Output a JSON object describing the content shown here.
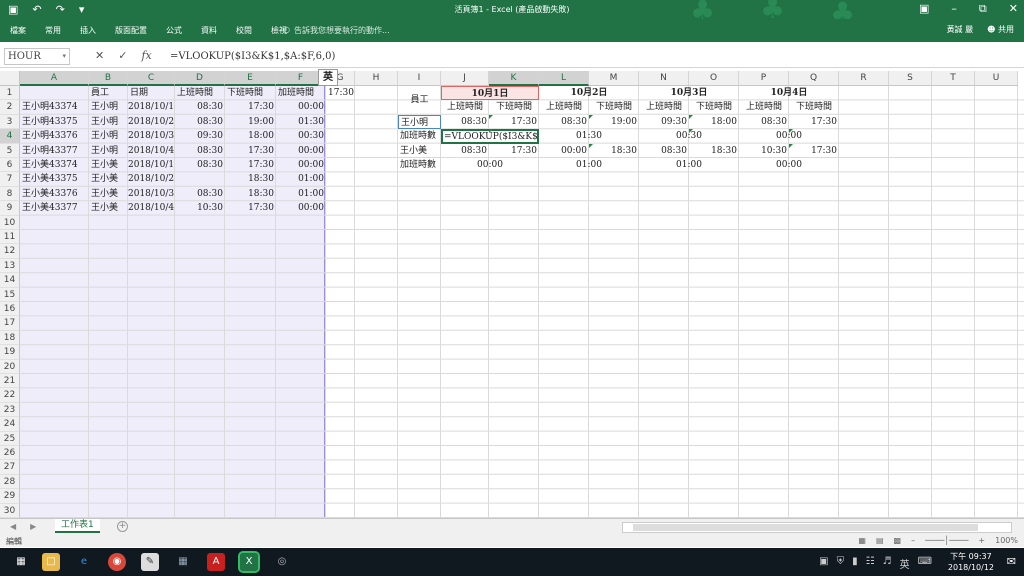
{
  "window": {
    "title": "活頁簿1 - Excel (產品啟動失敗)",
    "qat_icons": [
      "save-icon",
      "undo-icon",
      "redo-icon",
      "customize-icon"
    ]
  },
  "ribbon": {
    "tabs": [
      "檔案",
      "常用",
      "插入",
      "版面配置",
      "公式",
      "資料",
      "校閱",
      "檢視"
    ],
    "tell_me": "告訴我您想要執行的動作...",
    "user": "黃誠 嚴",
    "share": "共用"
  },
  "formula_bar": {
    "name_box": "HOUR",
    "formula": "=VLOOKUP($I3&K$1,$A:$F,6,0)"
  },
  "columns": [
    "A",
    "B",
    "C",
    "D",
    "E",
    "F",
    "G",
    "H",
    "I",
    "J",
    "K",
    "L",
    "M",
    "N",
    "O",
    "P",
    "Q",
    "R",
    "S",
    "T",
    "U"
  ],
  "rows": [
    "1",
    "2",
    "3",
    "4",
    "5",
    "6",
    "7",
    "8",
    "9",
    "10",
    "11",
    "12",
    "13",
    "14",
    "15",
    "16",
    "17",
    "18",
    "19",
    "20",
    "21",
    "22",
    "23",
    "24",
    "25",
    "26",
    "27",
    "28",
    "29",
    "30"
  ],
  "source_table": {
    "headers": [
      "",
      "員工",
      "日期",
      "上班時間",
      "下班時間",
      "加班時間"
    ],
    "rows": [
      [
        "王小明43374",
        "王小明",
        "2018/10/1",
        "08:30",
        "17:30",
        "00:00"
      ],
      [
        "王小明43375",
        "王小明",
        "2018/10/2",
        "08:30",
        "19:00",
        "01:30"
      ],
      [
        "王小明43376",
        "王小明",
        "2018/10/3",
        "09:30",
        "18:00",
        "00:30"
      ],
      [
        "王小明43377",
        "王小明",
        "2018/10/4",
        "08:30",
        "17:30",
        "00:00"
      ],
      [
        "王小美43374",
        "王小美",
        "2018/10/1",
        "08:30",
        "17:30",
        "00:00"
      ],
      [
        "王小美43375",
        "王小美",
        "2018/10/2",
        "",
        "18:30",
        "01:00"
      ],
      [
        "王小美43376",
        "王小美",
        "2018/10/3",
        "08:30",
        "18:30",
        "01:00"
      ],
      [
        "王小美43377",
        "王小美",
        "2018/10/4",
        "10:30",
        "17:30",
        "00:00"
      ]
    ]
  },
  "overflow_g1": "17:30",
  "ime_indicator": "英",
  "summary": {
    "employee_header": "員工",
    "dates": [
      "10月1日",
      "10月2日",
      "10月3日",
      "10月4日"
    ],
    "sub_headers": [
      "上班時間",
      "下班時間"
    ],
    "rows": [
      {
        "label": "王小明",
        "times": [
          "08:30",
          "17:30",
          "08:30",
          "19:00",
          "09:30",
          "18:00",
          "08:30",
          "17:30"
        ]
      },
      {
        "label": "加班時數",
        "editing": "=VLOOKUP($I3&K$1,",
        "overtime": [
          "01:30",
          "00:30",
          "00:00"
        ]
      },
      {
        "label": "王小美",
        "times": [
          "08:30",
          "17:30",
          "00:00",
          "18:30",
          "08:30",
          "18:30",
          "10:30",
          "17:30"
        ]
      },
      {
        "label": "加班時數",
        "overtime": [
          "00:00",
          "01:00",
          "01:00",
          "00:00"
        ]
      }
    ]
  },
  "sheet": {
    "tab": "工作表1"
  },
  "status": {
    "mode": "編輯",
    "zoom": "100%"
  },
  "taskbar": {
    "time": "下午 09:37",
    "date": "2018/10/12",
    "ime": "英"
  }
}
